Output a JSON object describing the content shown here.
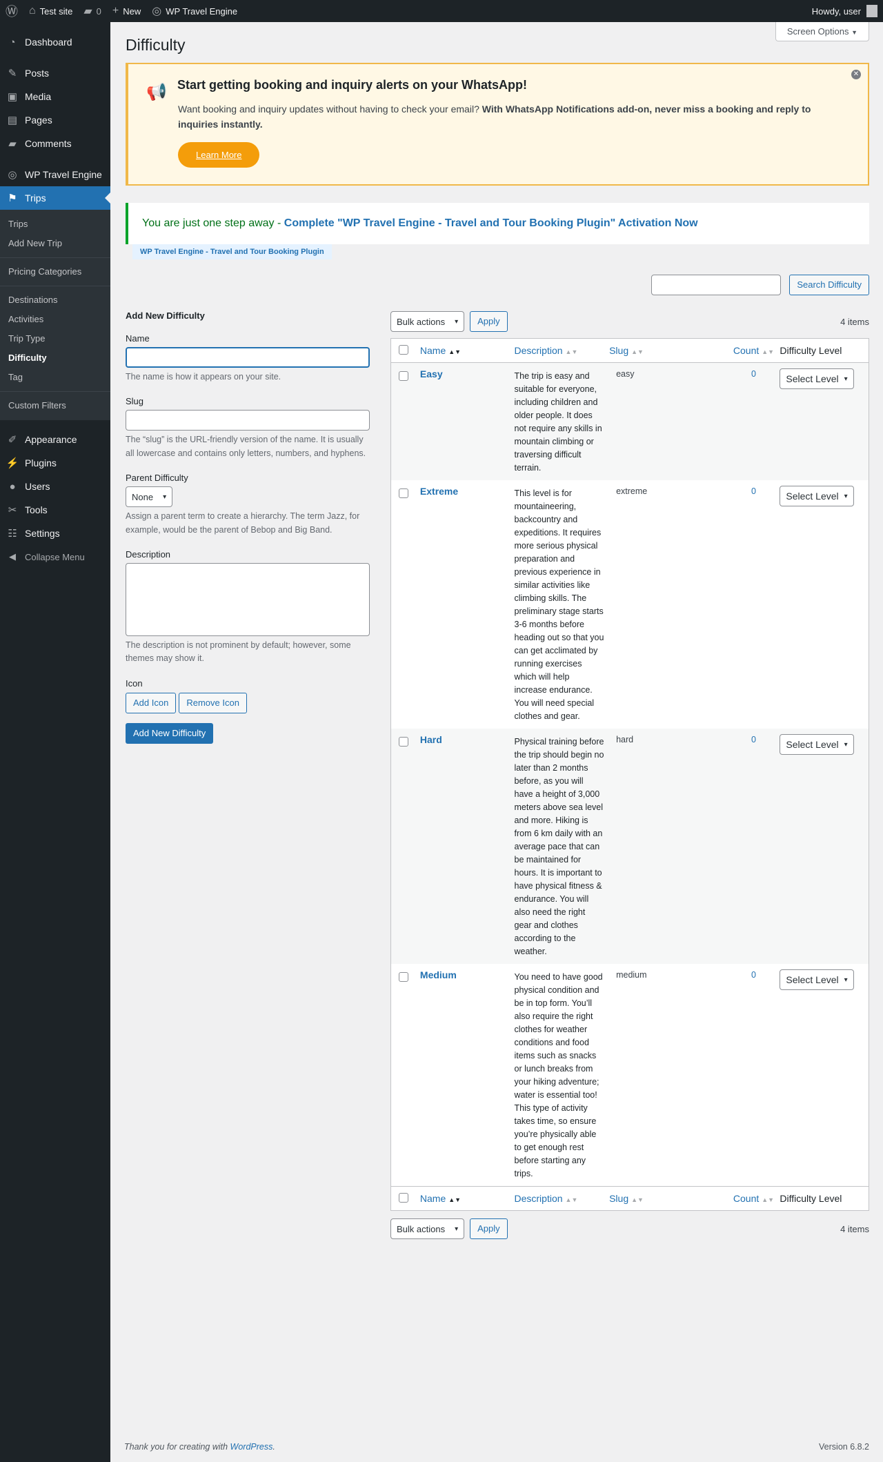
{
  "admin_bar": {
    "site_name": "Test site",
    "comments_count": "0",
    "new_label": "New",
    "plugin_label": "WP Travel Engine",
    "howdy": "Howdy, user"
  },
  "menu": {
    "dashboard": "Dashboard",
    "posts": "Posts",
    "media": "Media",
    "pages": "Pages",
    "comments": "Comments",
    "wte": "WP Travel Engine",
    "trips": "Trips",
    "sub": {
      "trips": "Trips",
      "add_new_trip": "Add New Trip",
      "pricing_categories": "Pricing Categories",
      "destinations": "Destinations",
      "activities": "Activities",
      "trip_type": "Trip Type",
      "difficulty": "Difficulty",
      "tag": "Tag",
      "custom_filters": "Custom Filters"
    },
    "appearance": "Appearance",
    "plugins": "Plugins",
    "users": "Users",
    "tools": "Tools",
    "settings": "Settings",
    "collapse": "Collapse Menu"
  },
  "page": {
    "title": "Difficulty",
    "screen_options": "Screen Options"
  },
  "promo": {
    "title": "Start getting booking and inquiry alerts on your WhatsApp!",
    "text_plain": "Want booking and inquiry updates without having to check your email? ",
    "text_bold": "With WhatsApp Notifications add-on, never miss a booking and reply to inquiries instantly.",
    "button": "Learn More"
  },
  "notice": {
    "text": "You are just one step away - ",
    "link": "Complete \"WP Travel Engine - Travel and Tour Booking Plugin\" Activation Now",
    "plugin_tag": "WP Travel Engine - Travel and Tour Booking Plugin"
  },
  "search": {
    "button": "Search Difficulty"
  },
  "form": {
    "heading": "Add New Difficulty",
    "name_label": "Name",
    "name_help": "The name is how it appears on your site.",
    "slug_label": "Slug",
    "slug_help": "The “slug” is the URL-friendly version of the name. It is usually all lowercase and contains only letters, numbers, and hyphens.",
    "parent_label": "Parent Difficulty",
    "parent_value": "None",
    "parent_help": "Assign a parent term to create a hierarchy. The term Jazz, for example, would be the parent of Bebop and Big Band.",
    "desc_label": "Description",
    "desc_help": "The description is not prominent by default; however, some themes may show it.",
    "icon_label": "Icon",
    "add_icon": "Add Icon",
    "remove_icon": "Remove Icon",
    "submit": "Add New Difficulty"
  },
  "table": {
    "bulk_actions": "Bulk actions",
    "apply": "Apply",
    "items_count": "4 items",
    "columns": {
      "name": "Name",
      "description": "Description",
      "slug": "Slug",
      "count": "Count",
      "level": "Difficulty Level"
    },
    "select_level": "Select Level",
    "rows": [
      {
        "name": "Easy",
        "description": "The trip is easy and suitable for everyone, including children and older people. It does not require any skills in mountain climbing or traversing difficult terrain.",
        "slug": "easy",
        "count": "0"
      },
      {
        "name": "Extreme",
        "description": "This level is for mountaineering, backcountry and expeditions. It requires more serious physical preparation and previous experience in similar activities like climbing skills. The preliminary stage starts 3-6 months before heading out so that you can get acclimated by running exercises which will help increase endurance. You will need special clothes and gear.",
        "slug": "extreme",
        "count": "0"
      },
      {
        "name": "Hard",
        "description": "Physical training before the trip should begin no later than 2 months before, as you will have a height of 3,000 meters above sea level and more. Hiking is from 6 km daily with an average pace that can be maintained for hours. It is important to have physical fitness & endurance. You will also need the right gear and clothes according to the weather.",
        "slug": "hard",
        "count": "0"
      },
      {
        "name": "Medium",
        "description": "You need to have good physical condition and be in top form. You’ll also require the right clothes for weather conditions and food items such as snacks or lunch breaks from your hiking adventure; water is essential too! This type of activity takes time, so ensure you’re physically able to get enough rest before starting any trips.",
        "slug": "medium",
        "count": "0"
      }
    ]
  },
  "footer": {
    "thanks": "Thank you for creating with ",
    "wp_link": "WordPress",
    "version": "Version 6.8.2"
  }
}
